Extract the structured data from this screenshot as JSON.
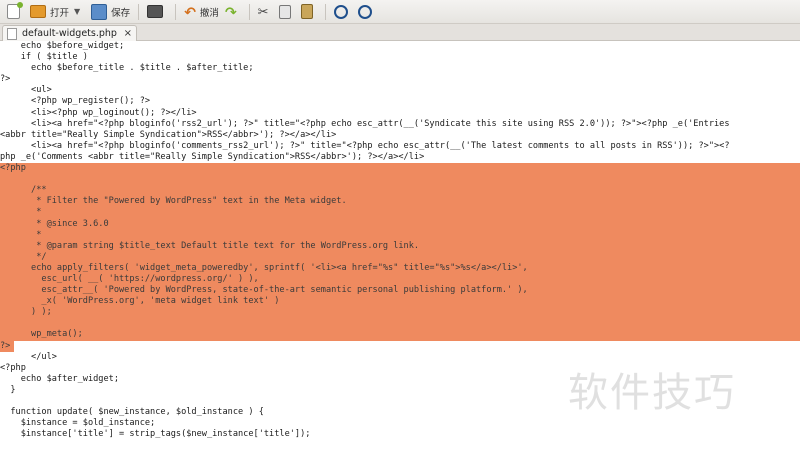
{
  "toolbar": {
    "open_label": "打开",
    "save_label": "保存",
    "undo_label": "撤消"
  },
  "tab": {
    "title": "default-widgets.php",
    "close_glyph": "×"
  },
  "code": {
    "l01": "    echo $before_widget;",
    "l02": "    if ( $title )",
    "l03": "      echo $before_title . $title . $after_title;",
    "l04": "?>",
    "l05": "      <ul>",
    "l06": "      <?php wp_register(); ?>",
    "l07": "      <li><?php wp_loginout(); ?></li>",
    "l08": "      <li><a href=\"<?php bloginfo('rss2_url'); ?>\" title=\"<?php echo esc_attr(__('Syndicate this site using RSS 2.0')); ?>\"><?php _e('Entries",
    "l09": "<abbr title=\"Really Simple Syndication\">RSS</abbr>'); ?></a></li>",
    "l10": "      <li><a href=\"<?php bloginfo('comments_rss2_url'); ?>\" title=\"<?php echo esc_attr(__('The latest comments to all posts in RSS')); ?>\"><?",
    "l11": "php _e('Comments <abbr title=\"Really Simple Syndication\">RSS</abbr>'); ?></a></li>",
    "l12": "<?php",
    "l13": "",
    "l14": "      /**",
    "l15": "       * Filter the \"Powered by WordPress\" text in the Meta widget.",
    "l16": "       *",
    "l17": "       * @since 3.6.0",
    "l18": "       *",
    "l19": "       * @param string $title_text Default title text for the WordPress.org link.",
    "l20": "       */",
    "l21": "      echo apply_filters( 'widget_meta_poweredby', sprintf( '<li><a href=\"%s\" title=\"%s\">%s</a></li>',",
    "l22": "        esc_url( __( 'https://wordpress.org/' ) ),",
    "l23": "        esc_attr__( 'Powered by WordPress, state-of-the-art semantic personal publishing platform.' ),",
    "l24": "        _x( 'WordPress.org', 'meta widget link text' )",
    "l25": "      ) );",
    "l26": "",
    "l27": "      wp_meta();",
    "l28": "?>",
    "l29": "      </ul>",
    "l30": "<?php",
    "l31": "    echo $after_widget;",
    "l32": "  }",
    "l33": "",
    "l34": "  function update( $new_instance, $old_instance ) {",
    "l35": "    $instance = $old_instance;",
    "l36": "    $instance['title'] = strip_tags($new_instance['title']);"
  },
  "watermark": "软件技巧",
  "colors": {
    "selection": "#ef8a5f",
    "keyword": "#8c0f2c",
    "variable": "#3b4ca6",
    "string": "#c2262b"
  }
}
